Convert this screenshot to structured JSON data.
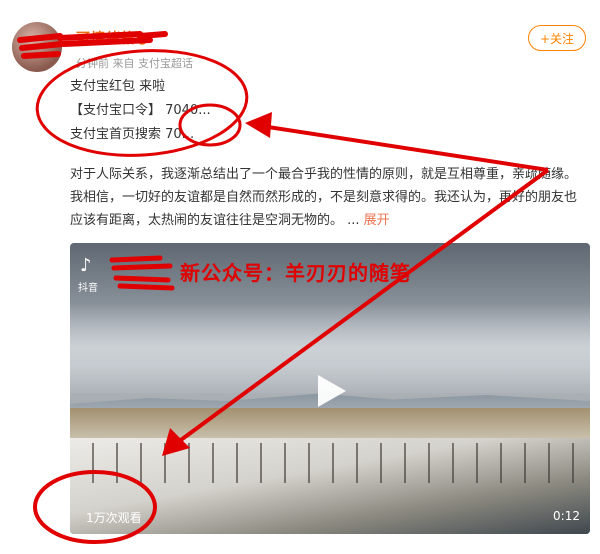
{
  "header": {
    "username": "可情绪格●",
    "meta": "分钟前 来自 支付宝超话",
    "follow_label": "+关注"
  },
  "post": {
    "line1": "支付宝红包 来啦",
    "line2": "【支付宝口令】 7040...",
    "line3": "支付宝首页搜索 70...",
    "body": "对于人际关系，我逐渐总结出了一个最合乎我的性情的原则，就是互相尊重，亲疏随缘。我相信，一切好的友谊都是自然而然形成的，不是刻意求得的。我还认为，再好的朋友也应该有距离，太热闹的友谊往往是空洞无物的。 ...",
    "expand_label": "展开"
  },
  "video": {
    "platform": "抖音",
    "overlay_title": "新公众号：羊刃刃的随笔",
    "views": "1万次观看",
    "duration": "0:12"
  },
  "colors": {
    "annotation": "#e00000",
    "follow": "#ff8200",
    "expand": "#eb7350"
  }
}
